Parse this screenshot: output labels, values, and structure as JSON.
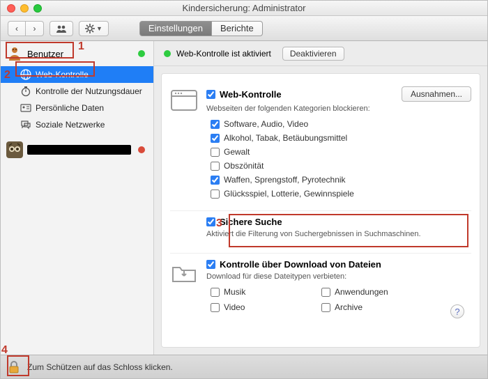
{
  "window": {
    "title": "Kindersicherung: Administrator"
  },
  "toolbar": {
    "nav_back": "‹",
    "nav_fwd": "›",
    "tabs": [
      {
        "label": "Einstellungen",
        "active": true
      },
      {
        "label": "Berichte",
        "active": false
      }
    ]
  },
  "sidebar": {
    "user1": {
      "name": "Benutzer"
    },
    "categories": [
      {
        "label": "Web-Kontrolle",
        "icon": "globe-icon",
        "selected": true
      },
      {
        "label": "Kontrolle der Nutzungsdauer",
        "icon": "stopwatch-icon",
        "selected": false
      },
      {
        "label": "Persönliche Daten",
        "icon": "idcard-icon",
        "selected": false
      },
      {
        "label": "Soziale Netzwerke",
        "icon": "chat-icon",
        "selected": false
      }
    ]
  },
  "status": {
    "text": "Web-Kontrolle ist aktiviert",
    "button": "Deaktivieren"
  },
  "sections": {
    "web": {
      "title": "Web-Kontrolle",
      "enabled": true,
      "subtitle": "Webseiten der folgenden Kategorien blockieren:",
      "exceptions_btn": "Ausnahmen...",
      "cats": [
        {
          "label": "Software, Audio, Video",
          "checked": true
        },
        {
          "label": "Alkohol, Tabak, Betäubungsmittel",
          "checked": true
        },
        {
          "label": "Gewalt",
          "checked": false
        },
        {
          "label": "Obszönität",
          "checked": false
        },
        {
          "label": "Waffen, Sprengstoff, Pyrotechnik",
          "checked": true
        },
        {
          "label": "Glücksspiel, Lotterie, Gewinnspiele",
          "checked": false
        }
      ]
    },
    "safesearch": {
      "title": "Sichere Suche",
      "enabled": true,
      "subtitle": "Aktiviert die Filterung von Suchergebnissen in Suchmaschinen."
    },
    "download": {
      "title": "Kontrolle über Download von Dateien",
      "enabled": true,
      "subtitle": "Download für diese Dateitypen verbieten:",
      "items": [
        {
          "label": "Musik",
          "checked": false
        },
        {
          "label": "Anwendungen",
          "checked": false
        },
        {
          "label": "Video",
          "checked": false
        },
        {
          "label": "Archive",
          "checked": false
        }
      ]
    }
  },
  "footer": {
    "lock_hint": "Zum Schützen auf das Schloss klicken."
  },
  "annotations": {
    "1": "1",
    "2": "2",
    "3": "3",
    "4": "4"
  }
}
